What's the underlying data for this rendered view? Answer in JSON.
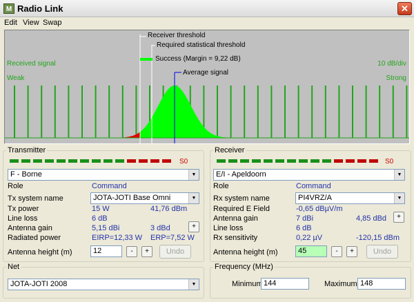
{
  "window": {
    "title": "Radio Link",
    "app_icon": "radio-mobile-icon",
    "close_glyph": "✕",
    "icon_text": "M"
  },
  "menu": {
    "items": [
      "Edit",
      "View",
      "Swap"
    ]
  },
  "graph": {
    "received_signal_label": "Received signal",
    "scale_label": "10 dB/div",
    "weak_label": "Weak",
    "strong_label": "Strong",
    "receiver_threshold_label": "Receiver threshold",
    "required_threshold_label": "Required statistical threshold",
    "success_label": "Success (Margin = 9,22 dB)",
    "average_label": "Average signal",
    "colors": {
      "background": "#c0c0c0",
      "bars": "#22a51c",
      "fail": "#e00000",
      "pass": "#00ff00",
      "average": "#0000ee",
      "threshold": "#ffffff"
    }
  },
  "transmitter": {
    "legend": "Transmitter",
    "meter_value": "S0",
    "site": "F - Borne",
    "role_label": "Role",
    "role_value": "Command",
    "system_label": "Tx system name",
    "system_value": "JOTA-JOTI Base Omni",
    "power_label": "Tx power",
    "power_w": "15 W",
    "power_dbm": "41,76 dBm",
    "line_loss_label": "Line loss",
    "line_loss": "6 dB",
    "gain_label": "Antenna gain",
    "gain_dbi": "5,15 dBi",
    "gain_dbd": "3 dBd",
    "radiated_label": "Radiated power",
    "eirp": "EIRP=12,33 W",
    "erp": "ERP=7,52 W",
    "height_label": "Antenna height (m)",
    "height_value": "12",
    "minus": "-",
    "plus": "+",
    "undo_label": "Undo"
  },
  "receiver": {
    "legend": "Receiver",
    "meter_value": "S0",
    "site": "E/I - Apeldoorn",
    "role_label": "Role",
    "role_value": "Command",
    "system_label": "Rx system name",
    "system_value": "PI4VRZ/A",
    "req_field_label": "Required E Field",
    "req_field": "-0,65 dBµV/m",
    "gain_label": "Antenna gain",
    "gain_dbi": "7 dBi",
    "gain_dbd": "4,85 dBd",
    "line_loss_label": "Line loss",
    "line_loss": "6 dB",
    "sens_label": "Rx sensitivity",
    "sens_uv": "0,22 µV",
    "sens_dbm": "-120,15 dBm",
    "height_label": "Antenna height (m)",
    "height_value": "45",
    "minus": "-",
    "plus": "+",
    "undo_label": "Undo"
  },
  "net": {
    "legend": "Net",
    "value": "JOTA-JOTI 2008"
  },
  "frequency": {
    "legend": "Frequency (MHz)",
    "min_label": "Minimum",
    "min_value": "144",
    "max_label": "Maximum",
    "max_value": "148"
  }
}
